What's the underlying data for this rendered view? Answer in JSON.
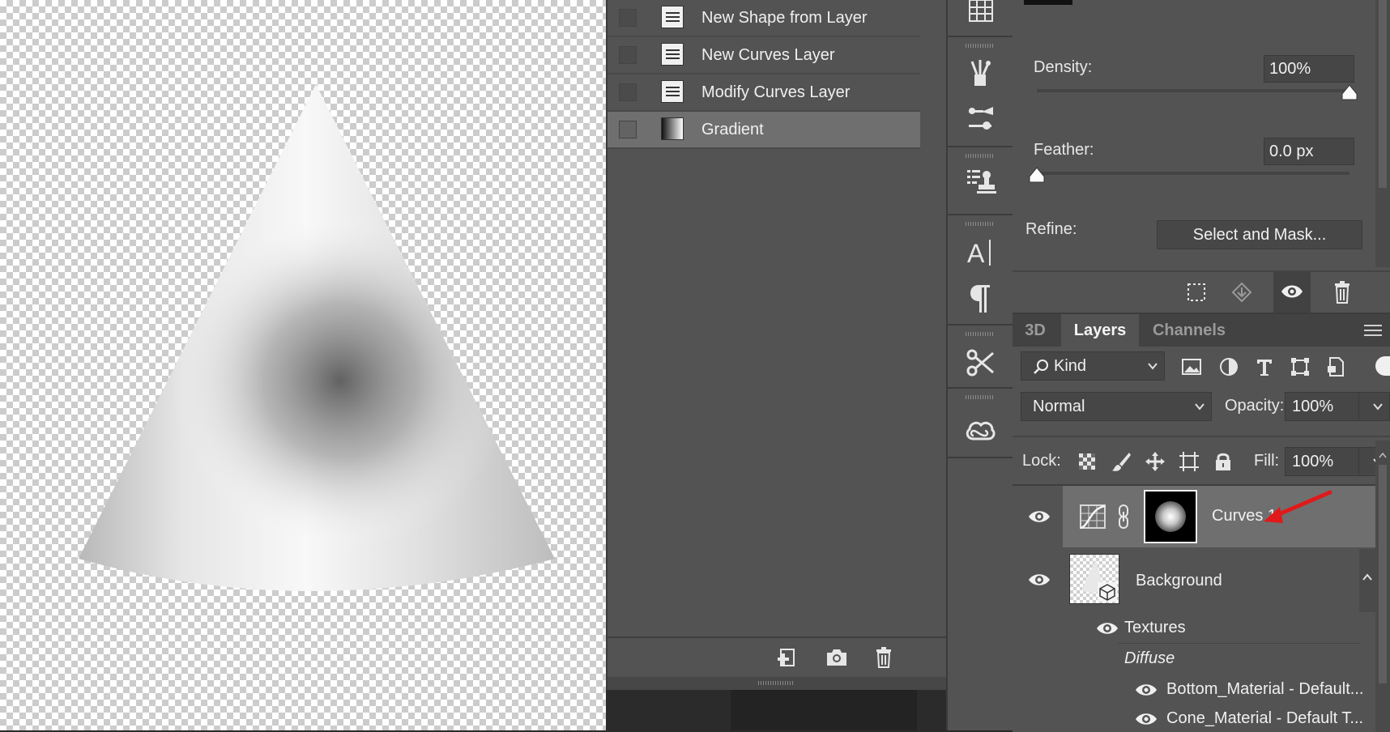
{
  "history": {
    "items": [
      {
        "label": "New Shape from Layer",
        "icon": "document-icon",
        "selected": false
      },
      {
        "label": "New Curves Layer",
        "icon": "document-icon",
        "selected": false
      },
      {
        "label": "Modify Curves Layer",
        "icon": "document-icon",
        "selected": false
      },
      {
        "label": "Gradient",
        "icon": "gradient-icon",
        "selected": true
      }
    ]
  },
  "properties": {
    "density_label": "Density:",
    "density_value": "100%",
    "density_level": 1.0,
    "feather_label": "Feather:",
    "feather_value": "0.0 px",
    "feather_level": 0.0,
    "refine_label": "Refine:",
    "select_mask_label": "Select and Mask..."
  },
  "layers_panel": {
    "tabs": [
      {
        "label": "3D",
        "active": false
      },
      {
        "label": "Layers",
        "active": true
      },
      {
        "label": "Channels",
        "active": false
      }
    ],
    "filter_kind": "Kind",
    "blend_mode": "Normal",
    "opacity_label": "Opacity:",
    "opacity_value": "100%",
    "lock_label": "Lock:",
    "fill_label": "Fill:",
    "fill_value": "100%",
    "layers": [
      {
        "name": "Curves 1",
        "type": "adjustment-curves",
        "visible": true,
        "selected": true
      },
      {
        "name": "Background",
        "type": "3d-layer",
        "visible": true,
        "selected": false
      }
    ],
    "sublayers": [
      {
        "name": "Textures",
        "visible": true
      },
      {
        "name": "Diffuse",
        "italic": true
      },
      {
        "name": "Bottom_Material - Default...",
        "visible": true
      },
      {
        "name": "Cone_Material - Default T...",
        "visible": true
      }
    ]
  },
  "colors": {
    "panel_bg": "#535353",
    "selected_row": "#6f6f6f",
    "annotation_arrow": "#e0191b"
  }
}
